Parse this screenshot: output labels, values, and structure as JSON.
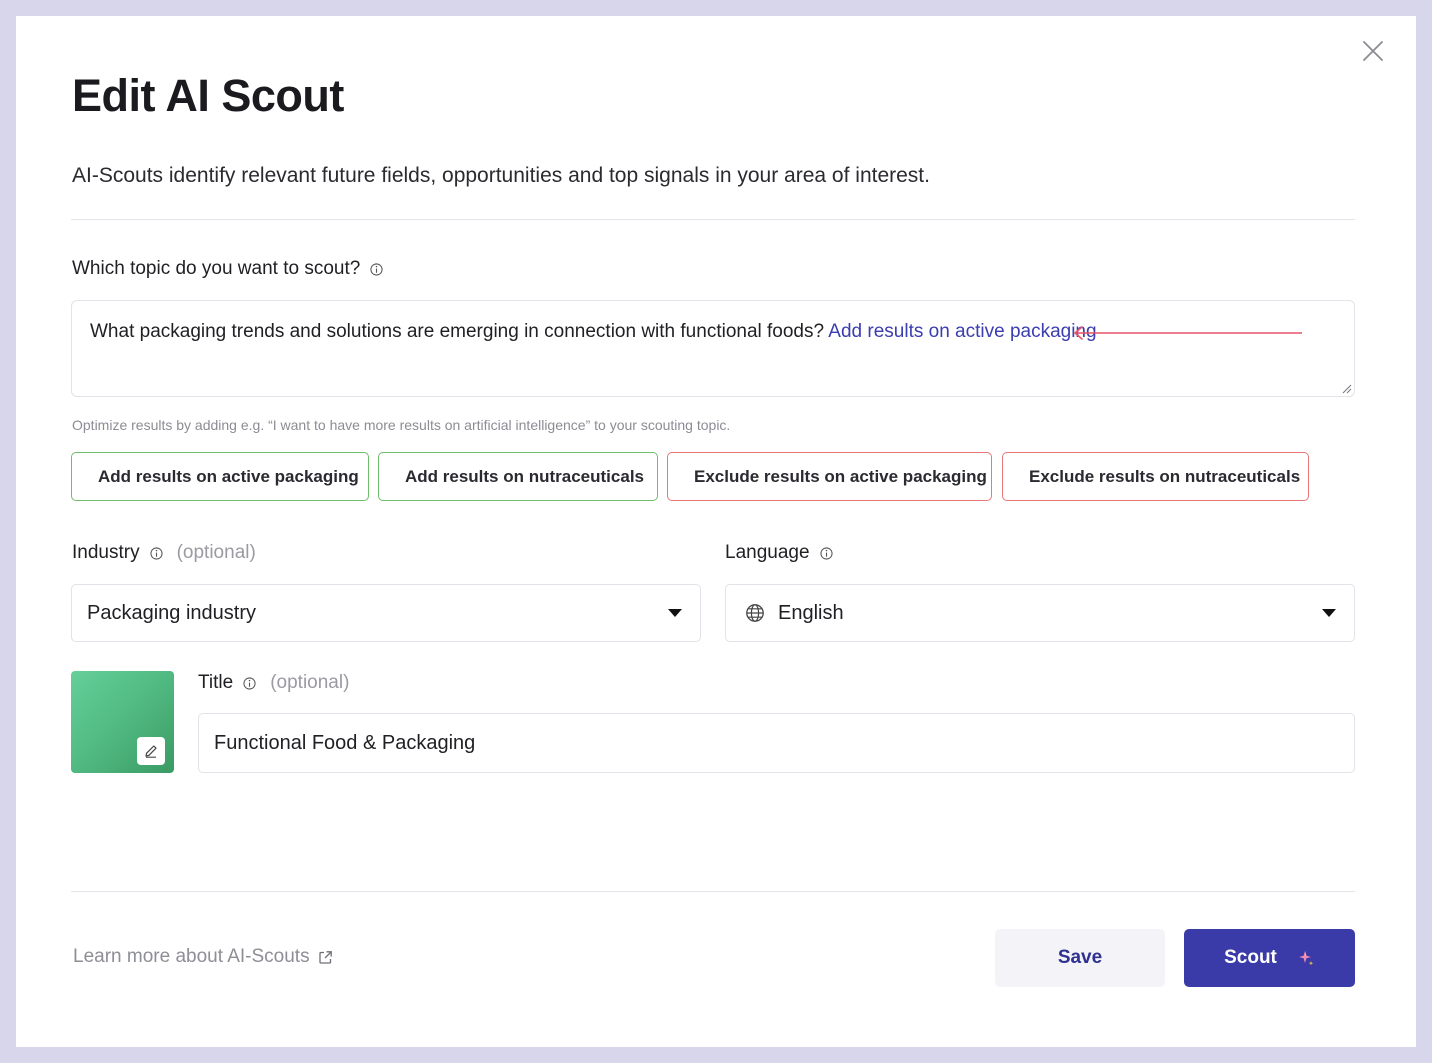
{
  "dialog": {
    "title": "Edit AI Scout",
    "subtitle": "AI-Scouts identify relevant future fields, opportunities and top signals in your area of interest."
  },
  "topic": {
    "label": "Which topic do you want to scout?",
    "value_text": "What packaging trends and solutions are emerging in connection with functional foods? ",
    "value_highlight": "Add results on active packaging",
    "hint": "Optimize results by adding e.g. “I want to have more results on artificial intelligence” to your scouting topic.",
    "annotation_arrow_color": "#e8546a",
    "suggestions": [
      {
        "label": "Add results on active packaging",
        "kind": "add",
        "icon": "sparkle-icon"
      },
      {
        "label": "Add results on nutraceuticals",
        "kind": "add",
        "icon": "sparkle-icon"
      },
      {
        "label": "Exclude results on active packaging",
        "kind": "exclude",
        "icon": "sparkle-icon"
      },
      {
        "label": "Exclude results on nutraceuticals",
        "kind": "exclude",
        "icon": "sparkle-icon"
      }
    ]
  },
  "industry": {
    "label": "Industry",
    "optional": "(optional)",
    "value": "Packaging industry"
  },
  "language": {
    "label": "Language",
    "value": "English"
  },
  "title_field": {
    "label": "Title",
    "optional": "(optional)",
    "value": "Functional Food & Packaging"
  },
  "footer": {
    "learn_more": "Learn more about AI-Scouts",
    "save_label": "Save",
    "scout_label": "Scout"
  },
  "colors": {
    "primary": "#3a3aa8",
    "link": "#3b3db0",
    "add_border": "#6fbf6a",
    "add_icon": "#3f9a3a",
    "exclude_border": "#ea7777",
    "exclude_icon": "#e04848",
    "backdrop": "#d8d6ea"
  }
}
